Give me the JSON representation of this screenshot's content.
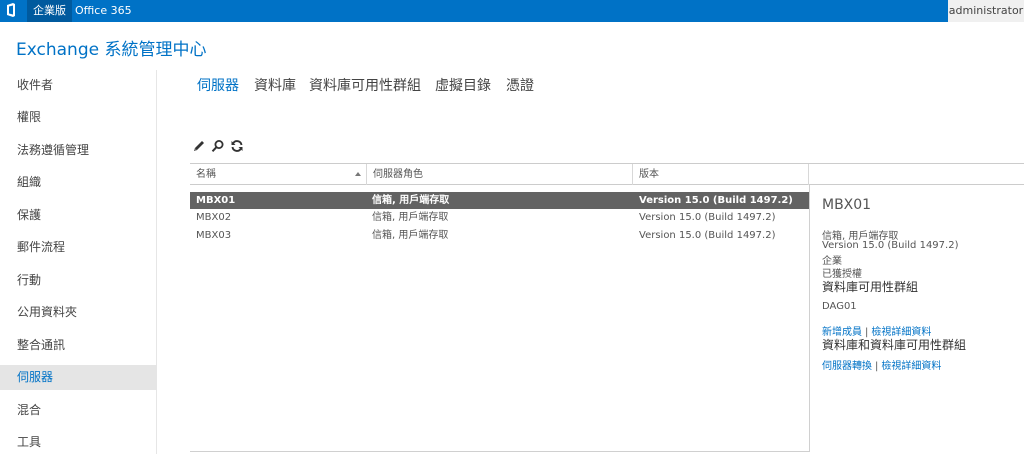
{
  "topbar": {
    "tab_enterprise": "企業版",
    "tab_office365": "Office 365",
    "user": "administrator"
  },
  "app": {
    "title": "Exchange 系統管理中心"
  },
  "sidebar": {
    "items": [
      {
        "label": "收件者"
      },
      {
        "label": "權限"
      },
      {
        "label": "法務遵循管理"
      },
      {
        "label": "組織"
      },
      {
        "label": "保護"
      },
      {
        "label": "郵件流程"
      },
      {
        "label": "行動"
      },
      {
        "label": "公用資料夾"
      },
      {
        "label": "整合通訊"
      },
      {
        "label": "伺服器"
      },
      {
        "label": "混合"
      },
      {
        "label": "工具"
      }
    ],
    "active_index": 9
  },
  "tabs": [
    {
      "label": "伺服器"
    },
    {
      "label": "資料庫"
    },
    {
      "label": "資料庫可用性群組"
    },
    {
      "label": "虛擬目錄"
    },
    {
      "label": "憑證"
    }
  ],
  "toolbar": {
    "edit_icon": "pencil-icon",
    "search_icon": "search-icon",
    "refresh_icon": "refresh-icon"
  },
  "table": {
    "columns": [
      {
        "label": "名稱"
      },
      {
        "label": "伺服器角色"
      },
      {
        "label": "版本"
      }
    ],
    "rows": [
      {
        "name": "MBX01",
        "role": "信箱, 用戶端存取",
        "version": "Version 15.0 (Build 1497.2)",
        "selected": true
      },
      {
        "name": "MBX02",
        "role": "信箱, 用戶端存取",
        "version": "Version 15.0 (Build 1497.2)",
        "selected": false
      },
      {
        "name": "MBX03",
        "role": "信箱, 用戶端存取",
        "version": "Version 15.0 (Build 1497.2)",
        "selected": false
      }
    ]
  },
  "details": {
    "title": "MBX01",
    "roles": "信箱, 用戶端存取",
    "version": "Version 15.0 (Build 1497.2)",
    "edition": "企業",
    "license": "已獲授權",
    "dag_heading": "資料庫可用性群組",
    "dag_name": "DAG01",
    "dag_link_add": "新增成員",
    "dag_link_view": "檢視詳細資料",
    "db_heading": "資料庫和資料庫可用性群組",
    "db_link_switchover": "伺服器轉換",
    "db_link_view": "檢視詳細資料",
    "link_separator": "|"
  },
  "colors": {
    "accent": "#0072c6",
    "topbar": "#0072c6",
    "selected_row": "#636363"
  }
}
